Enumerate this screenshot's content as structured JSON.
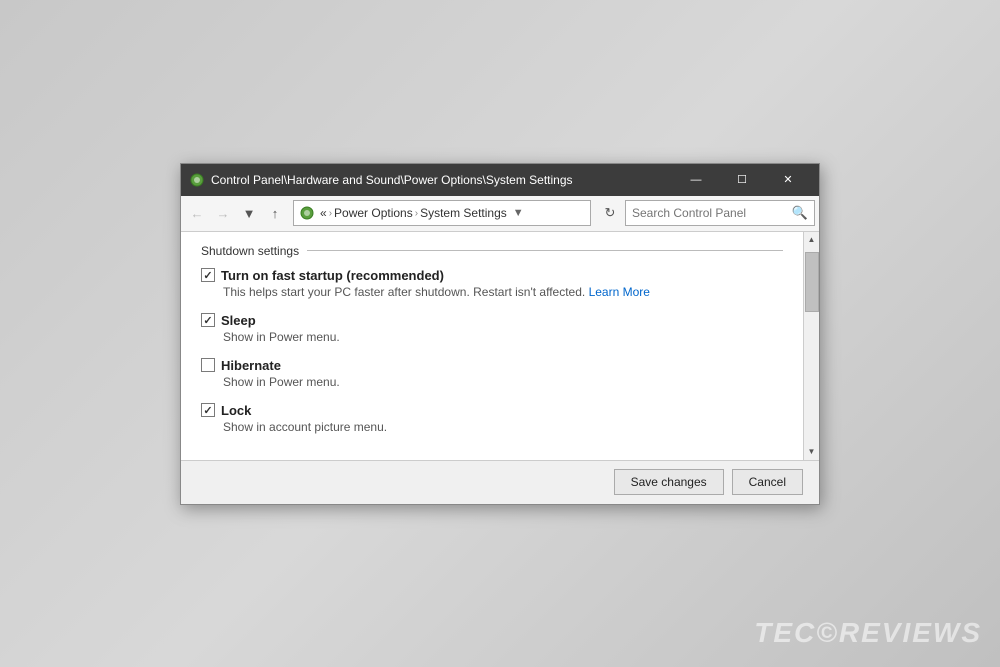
{
  "window": {
    "title": "Control Panel\\Hardware and Sound\\Power Options\\System Settings",
    "icon": "⚙",
    "controls": {
      "minimize": "—",
      "maximize": "☐",
      "close": "✕"
    }
  },
  "toolbar": {
    "back_disabled": true,
    "forward_disabled": true,
    "up_disabled": false,
    "address": {
      "icon": "🖥",
      "breadcrumb_more": "«",
      "power_options": "Power Options",
      "separator": "›",
      "system_settings": "System Settings"
    },
    "refresh_icon": "↻",
    "search_placeholder": "Search Control Panel",
    "search_icon": "🔍"
  },
  "content": {
    "section_label": "Shutdown settings",
    "settings": [
      {
        "id": "fast_startup",
        "checked": true,
        "label": "Turn on fast startup (recommended)",
        "description": "This helps start your PC faster after shutdown. Restart isn't affected.",
        "learn_more_text": "Learn More",
        "has_learn_more": true
      },
      {
        "id": "sleep",
        "checked": true,
        "label": "Sleep",
        "description": "Show in Power menu.",
        "has_learn_more": false
      },
      {
        "id": "hibernate",
        "checked": false,
        "label": "Hibernate",
        "description": "Show in Power menu.",
        "has_learn_more": false
      },
      {
        "id": "lock",
        "checked": true,
        "label": "Lock",
        "description": "Show in account picture menu.",
        "has_learn_more": false
      }
    ]
  },
  "footer": {
    "save_label": "Save changes",
    "cancel_label": "Cancel"
  },
  "watermark": "TEC©REVIEWS"
}
